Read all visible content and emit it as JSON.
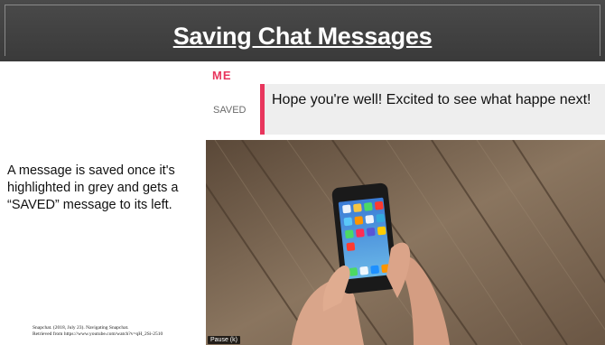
{
  "slide": {
    "title": "Saving Chat Messages",
    "description": "A message is saved once it's highlighted in grey and gets a “SAVED” message to its left.",
    "citation_line1": "Snapchat. (2018, July 23). Navigating Snapchat.",
    "citation_line2": "Retrieved from https://www.youtube.com/watch?v=qH_2Si-2510"
  },
  "chat": {
    "sender": "ME",
    "status": "SAVED",
    "message": "Hope you're well! Excited to see what happe next!"
  },
  "video": {
    "pause_label": "Pause (k)"
  },
  "colors": {
    "title_bar": "#3f3f3f",
    "accent": "#e8365d",
    "saved_highlight": "#eeeeee"
  }
}
